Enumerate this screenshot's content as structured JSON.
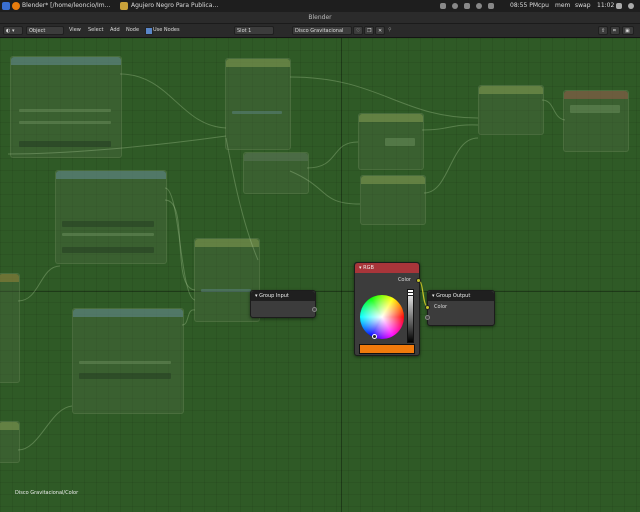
{
  "taskbar": {
    "app_label": "Blender* [/home/leoncio/Im…",
    "folder_label": "Agujero Negro Para Publica…",
    "time": "08:55 PM",
    "cpu": "cpu",
    "mem": "mem",
    "swap": "swap",
    "clock": "11:02"
  },
  "window": {
    "title": "Blender"
  },
  "header": {
    "mode": "Object",
    "menus": [
      "View",
      "Select",
      "Add",
      "Node"
    ],
    "use_nodes_label": "Use Nodes",
    "slot": "Slot 1",
    "material": "Disco Gravitacional"
  },
  "nodes": {
    "rgb": {
      "title": "RGB",
      "output_label": "Color",
      "swatch_color": "#f07a0c",
      "header_color": "#a8353a"
    },
    "group_input": {
      "title": "Group Input"
    },
    "group_output": {
      "title": "Group Output",
      "input_label": "Color"
    }
  },
  "breadcrumb": "Disco Gravitacional/Color",
  "colors": {
    "background": "#2f5a26",
    "node_body": "#3c3c3c",
    "color_socket": "#c8c629"
  }
}
